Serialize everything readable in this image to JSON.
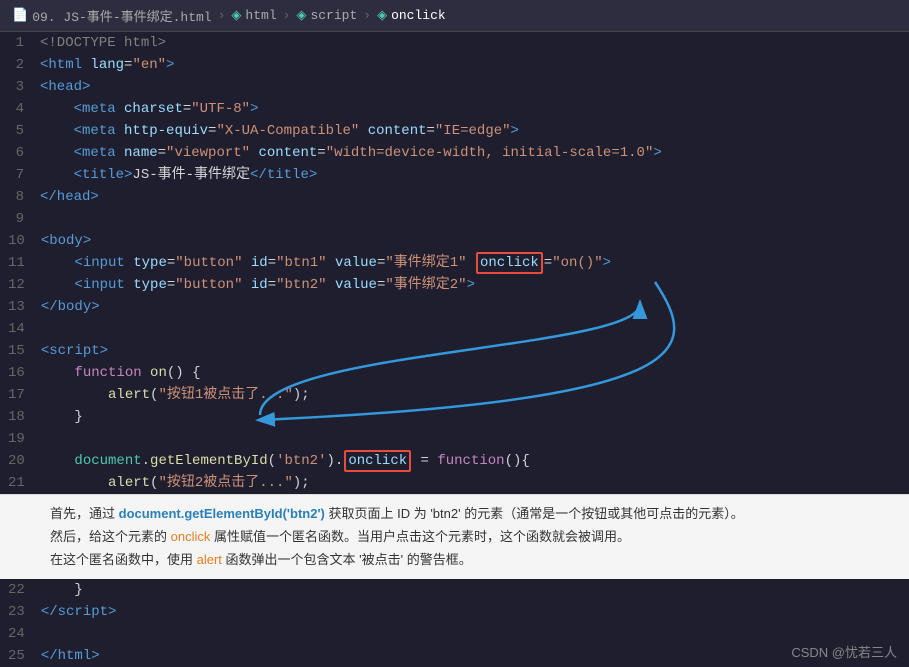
{
  "breadcrumb": {
    "items": [
      {
        "label": "09. JS-事件-事件绑定.html",
        "icon": "📄"
      },
      {
        "label": "html",
        "icon": "◈"
      },
      {
        "label": "script",
        "icon": "◈"
      },
      {
        "label": "onclick",
        "icon": "◈"
      }
    ]
  },
  "lines": [
    {
      "num": 1,
      "content": "<!DOCTYPE html>"
    },
    {
      "num": 2,
      "content": "<html lang=\"en\">"
    },
    {
      "num": 3,
      "content": "<head>"
    },
    {
      "num": 4,
      "content": "    <meta charset=\"UTF-8\">"
    },
    {
      "num": 5,
      "content": "    <meta http-equiv=\"X-UA-Compatible\" content=\"IE=edge\">"
    },
    {
      "num": 6,
      "content": "    <meta name=\"viewport\" content=\"width=device-width, initial-scale=1.0\">"
    },
    {
      "num": 7,
      "content": "    <title>JS-事件-事件绑定</title>"
    },
    {
      "num": 8,
      "content": "</head>"
    },
    {
      "num": 9,
      "content": ""
    },
    {
      "num": 10,
      "content": "<body>"
    },
    {
      "num": 11,
      "content": "    <input type=\"button\" id=\"btn1\" value=\"事件绑定1\" onclick=\"on()\">"
    },
    {
      "num": 12,
      "content": "    <input type=\"button\" id=\"btn2\" value=\"事件绑定2\">"
    },
    {
      "num": 13,
      "content": "</body>"
    },
    {
      "num": 14,
      "content": ""
    },
    {
      "num": 15,
      "content": "<script>"
    },
    {
      "num": 16,
      "content": "    function on() {"
    },
    {
      "num": 17,
      "content": "        alert(\"按钮1被点击了...\");"
    },
    {
      "num": 18,
      "content": "    }"
    },
    {
      "num": 19,
      "content": ""
    },
    {
      "num": 20,
      "content": "    document.getElementById('btn2').onclick = function(){"
    },
    {
      "num": 21,
      "content": "        alert(\"按钮2被点击了...\");"
    }
  ],
  "annotation": {
    "line1": "首先，通过 document.getElementById('btn2') 获取页面上 ID 为 'btn2' 的元素（通常是一个按钮或其他可点击的元素）。",
    "line2": "然后，给这个元素的 onclick 属性赋值一个匿名函数。当用户点击这个元素时，这个函数就会被调用。",
    "line3": "在这个匿名函数中，使用 alert 函数弹出一个包含文本 '被点击' 的警告框。"
  },
  "closing": {
    "line22": "22",
    "line23": "23",
    "line24": "24",
    "line25": "25"
  },
  "watermark": "CSDN @忧若三人"
}
